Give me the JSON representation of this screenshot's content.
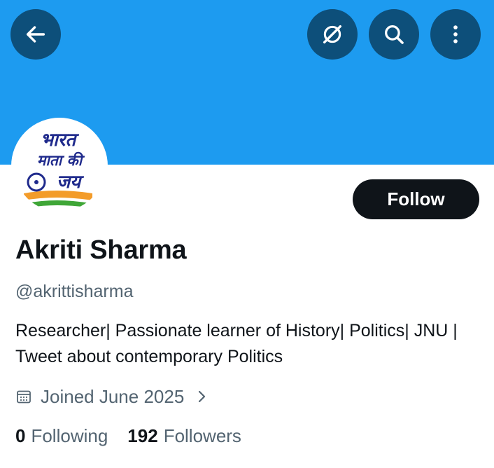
{
  "header": {
    "back_icon": "arrow-left-icon",
    "grok_icon": "grok-slash-circle-icon",
    "search_icon": "search-icon",
    "more_icon": "more-vertical-icon",
    "banner_color": "#1d9bf0",
    "button_color": "#0d4f7a"
  },
  "avatar": {
    "lines": [
      "भारत",
      "माता की",
      "जय"
    ]
  },
  "profile": {
    "follow_label": "Follow",
    "name": "Akriti Sharma",
    "handle": "@akrittisharma",
    "bio": "Researcher| Passionate learner of History| Politics| JNU | Tweet about contemporary Politics",
    "joined": "Joined June 2025",
    "following_count": "0",
    "following_label": "Following",
    "followers_count": "192",
    "followers_label": "Followers"
  }
}
